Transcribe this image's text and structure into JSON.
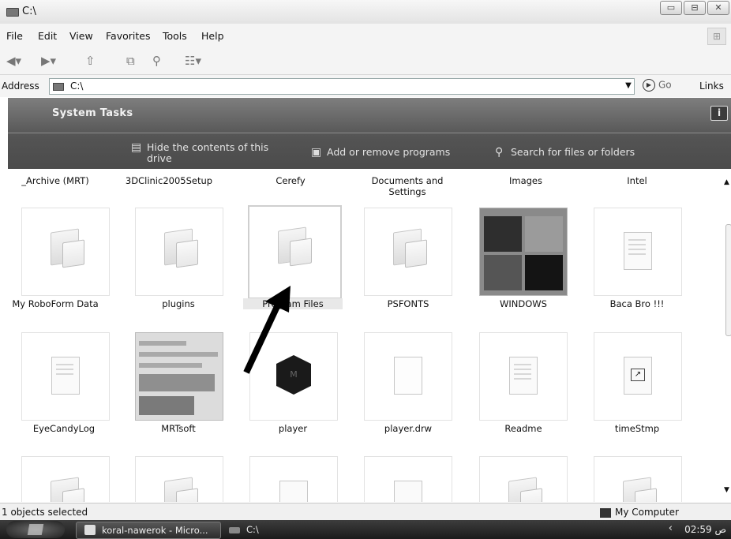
{
  "window": {
    "title": "C:\\",
    "controls": [
      "▭",
      "⊟",
      "✕"
    ]
  },
  "menu": [
    "File",
    "Edit",
    "View",
    "Favorites",
    "Tools",
    "Help"
  ],
  "address": {
    "label": "Address",
    "value": "C:\\",
    "go": "Go",
    "links": "Links"
  },
  "tasks": {
    "heading": "System Tasks",
    "info": "i",
    "items": [
      "Hide the contents of this drive",
      "Add or remove programs",
      "Search for files or folders"
    ]
  },
  "top_row_labels": [
    "_Archive (MRT)",
    "3DClinic2005Setup",
    "Cerefy",
    "Documents and Settings",
    "Images",
    "Intel"
  ],
  "row1_labels": [
    "My RoboForm Data",
    "plugins",
    "Program Files",
    "PSFONTS",
    "WINDOWS",
    "Baca Bro !!!"
  ],
  "row2_labels": [
    "EyeCandyLog",
    "MRTsoft",
    "player",
    "player.drw",
    "Readme",
    "timeStmp"
  ],
  "status": {
    "left": "1 objects selected",
    "right": "My Computer"
  },
  "taskbar": {
    "items": [
      "koral-nawerok - Micro...",
      "C:\\"
    ],
    "clock": "ص 02:59"
  },
  "colors": {
    "tasks_panel": "#5a5a5a",
    "selection_border": "#cfcfcf"
  }
}
